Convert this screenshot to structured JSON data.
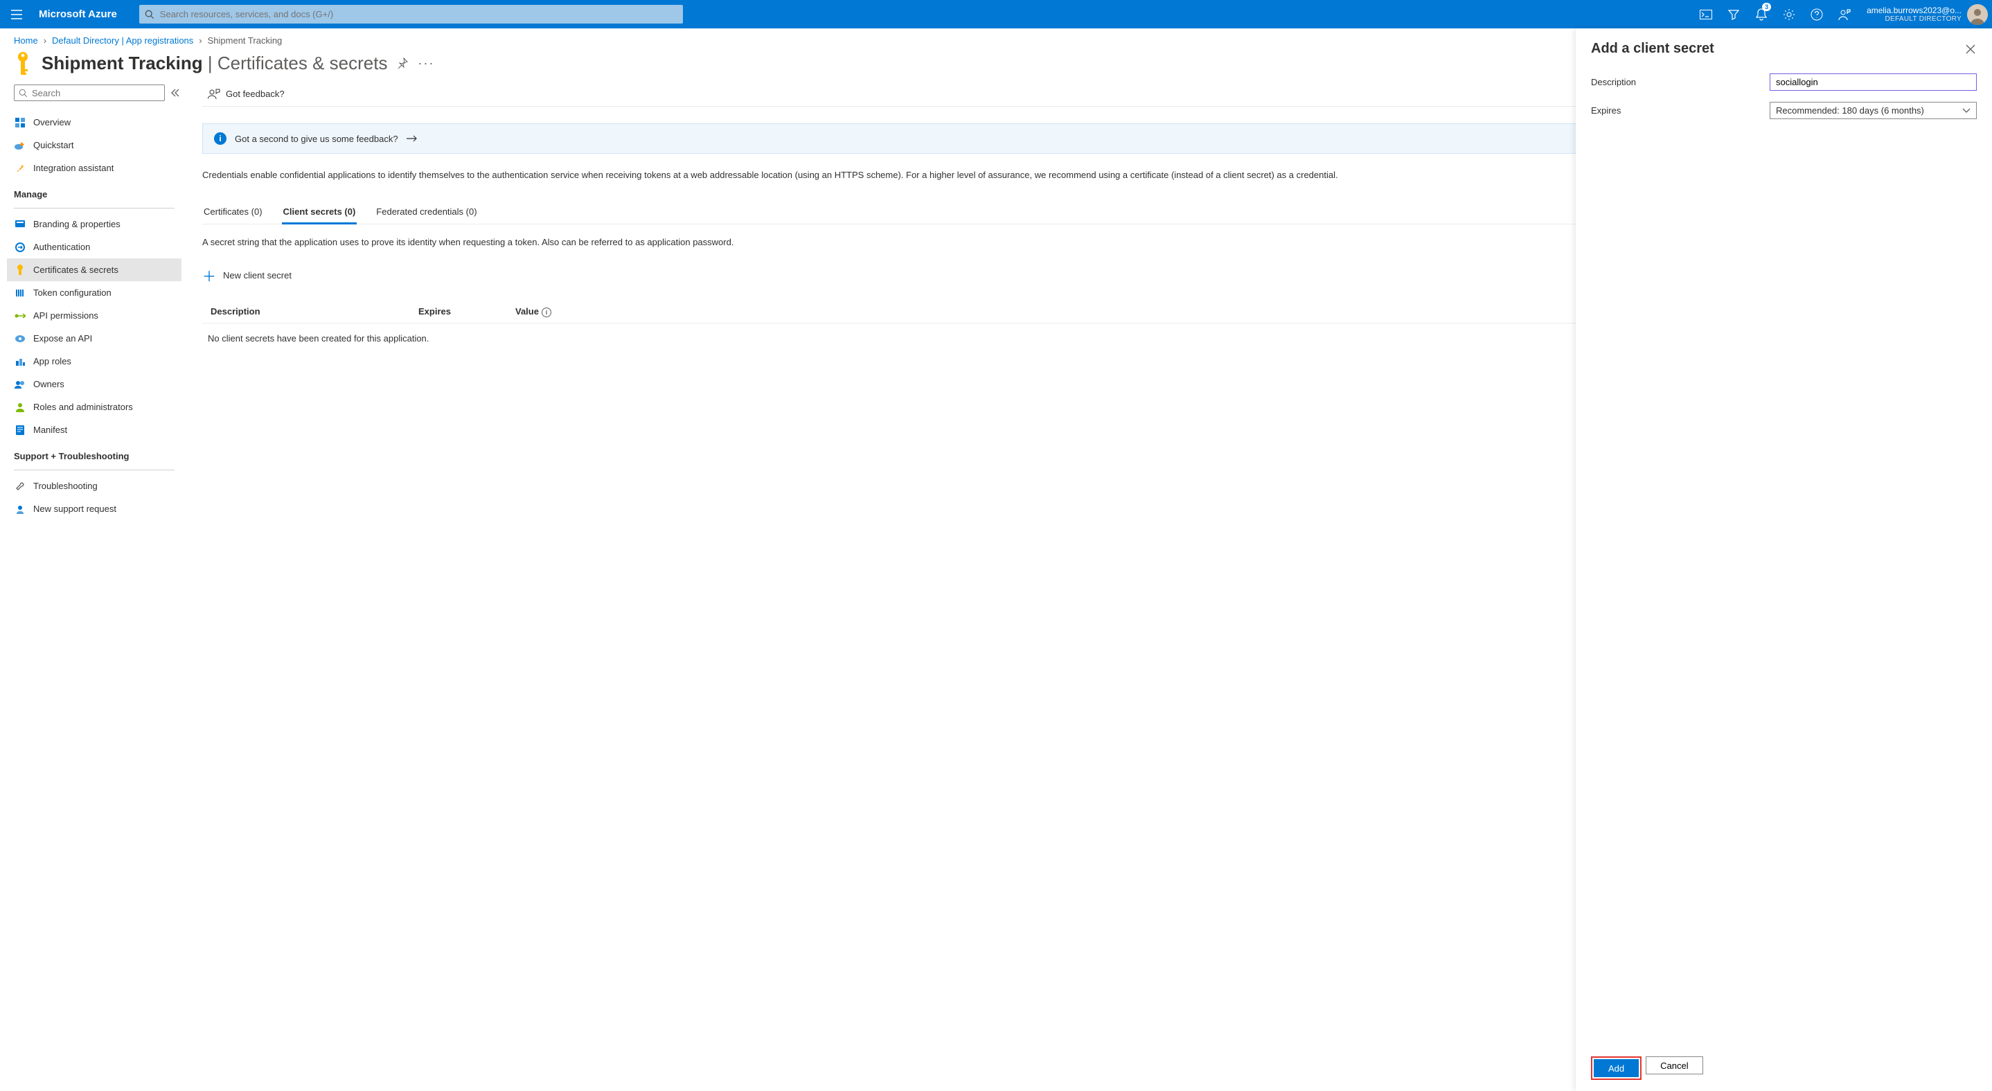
{
  "header": {
    "brand": "Microsoft Azure",
    "search_placeholder": "Search resources, services, and docs (G+/)",
    "notification_count": "3",
    "user_email": "amelia.burrows2023@o...",
    "user_directory": "DEFAULT DIRECTORY"
  },
  "breadcrumb": {
    "items": [
      "Home",
      "Default Directory | App registrations",
      "Shipment Tracking"
    ]
  },
  "page": {
    "title_main": "Shipment Tracking",
    "title_sub": "Certificates & secrets"
  },
  "left_nav": {
    "search_placeholder": "Search",
    "top_items": [
      {
        "label": "Overview",
        "icon": "grid-icon"
      },
      {
        "label": "Quickstart",
        "icon": "rocket-cloud-icon"
      },
      {
        "label": "Integration assistant",
        "icon": "rocket-icon"
      }
    ],
    "manage_label": "Manage",
    "manage_items": [
      {
        "label": "Branding & properties",
        "icon": "brand-icon"
      },
      {
        "label": "Authentication",
        "icon": "auth-icon"
      },
      {
        "label": "Certificates & secrets",
        "icon": "key-icon",
        "selected": true
      },
      {
        "label": "Token configuration",
        "icon": "token-icon"
      },
      {
        "label": "API permissions",
        "icon": "api-perm-icon"
      },
      {
        "label": "Expose an API",
        "icon": "expose-icon"
      },
      {
        "label": "App roles",
        "icon": "roles-icon"
      },
      {
        "label": "Owners",
        "icon": "owners-icon"
      },
      {
        "label": "Roles and administrators",
        "icon": "admin-icon"
      },
      {
        "label": "Manifest",
        "icon": "manifest-icon"
      }
    ],
    "support_label": "Support + Troubleshooting",
    "support_items": [
      {
        "label": "Troubleshooting",
        "icon": "wrench-icon"
      },
      {
        "label": "New support request",
        "icon": "support-icon"
      }
    ]
  },
  "content": {
    "toolbar_feedback": "Got feedback?",
    "banner_text": "Got a second to give us some feedback?",
    "intro_text": "Credentials enable confidential applications to identify themselves to the authentication service when receiving tokens at a web addressable location (using an HTTPS scheme). For a higher level of assurance, we recommend using a certificate (instead of a client secret) as a credential.",
    "tabs": [
      {
        "label": "Certificates (0)"
      },
      {
        "label": "Client secrets (0)",
        "selected": true
      },
      {
        "label": "Federated credentials (0)"
      }
    ],
    "tab_desc": "A secret string that the application uses to prove its identity when requesting a token. Also can be referred to as application password.",
    "new_secret_label": "New client secret",
    "table_headers": {
      "c1": "Description",
      "c2": "Expires",
      "c3": "Value"
    },
    "empty_text": "No client secrets have been created for this application."
  },
  "panel": {
    "title": "Add a client secret",
    "desc_label": "Description",
    "desc_value": "sociallogin",
    "expires_label": "Expires",
    "expires_value": "Recommended: 180 days (6 months)",
    "add_label": "Add",
    "cancel_label": "Cancel"
  }
}
